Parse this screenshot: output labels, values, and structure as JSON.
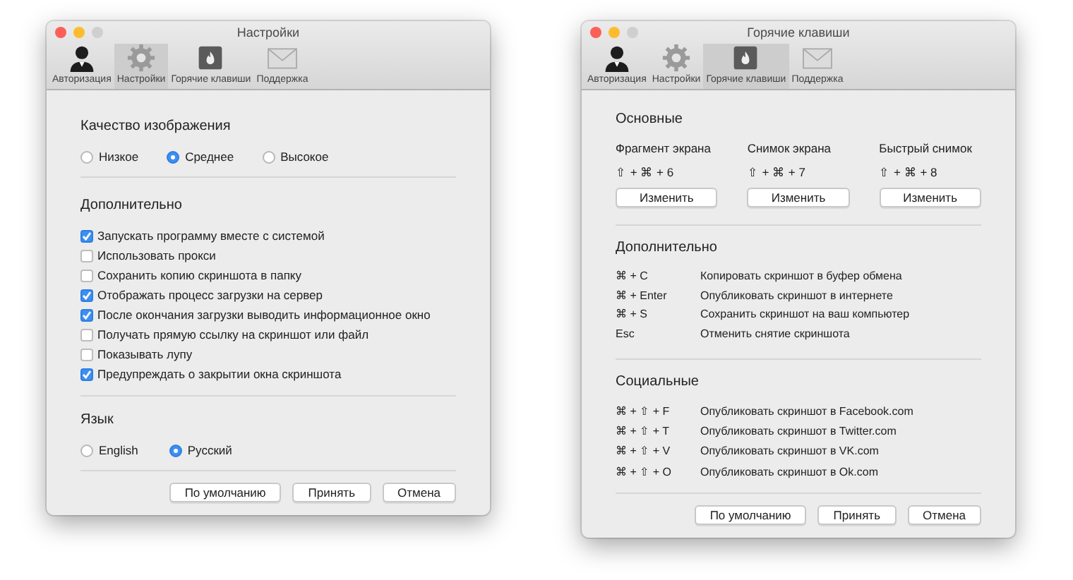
{
  "settings_window": {
    "title": "Настройки",
    "toolbar": [
      {
        "kind": "person",
        "label": "Авторизация",
        "selected": false
      },
      {
        "kind": "gear",
        "label": "Настройки",
        "selected": true
      },
      {
        "kind": "flame",
        "label": "Горячие клавиши",
        "selected": false
      },
      {
        "kind": "envelope",
        "label": "Поддержка",
        "selected": false
      }
    ],
    "quality": {
      "heading": "Качество изображения",
      "options": [
        {
          "label": "Низкое",
          "selected": false
        },
        {
          "label": "Среднее",
          "selected": true
        },
        {
          "label": "Высокое",
          "selected": false
        }
      ]
    },
    "additional": {
      "heading": "Дополнительно",
      "options": [
        {
          "label": "Запускать программу вместе с системой",
          "checked": true
        },
        {
          "label": "Использовать прокси",
          "checked": false
        },
        {
          "label": "Сохранить копию скриншота в папку",
          "checked": false
        },
        {
          "label": "Отображать процесс загрузки на сервер",
          "checked": true
        },
        {
          "label": "После окончания загрузки выводить информационное окно",
          "checked": true
        },
        {
          "label": "Получать прямую ссылку на скриншот или файл",
          "checked": false
        },
        {
          "label": "Показывать лупу",
          "checked": false
        },
        {
          "label": "Предупреждать о закрытии окна скриншота",
          "checked": true
        }
      ]
    },
    "language": {
      "heading": "Язык",
      "options": [
        {
          "label": "English",
          "selected": false
        },
        {
          "label": "Русский",
          "selected": true
        }
      ]
    },
    "buttons": [
      "По умолчанию",
      "Принять",
      "Отмена"
    ]
  },
  "hotkeys_window": {
    "title": "Горячие клавиши",
    "toolbar": [
      {
        "kind": "person",
        "label": "Авторизация",
        "selected": false
      },
      {
        "kind": "gear",
        "label": "Настройки",
        "selected": false
      },
      {
        "kind": "flame",
        "label": "Горячие клавиши",
        "selected": true
      },
      {
        "kind": "envelope",
        "label": "Поддержка",
        "selected": false
      }
    ],
    "main": {
      "heading": "Основные",
      "shortcuts": [
        {
          "name": "Фрагмент экрана",
          "keys": "⇧ + ⌘ + 6",
          "button": "Изменить"
        },
        {
          "name": "Снимок экрана",
          "keys": "⇧ + ⌘ + 7",
          "button": "Изменить"
        },
        {
          "name": "Быстрый снимок",
          "keys": "⇧ + ⌘ + 8",
          "button": "Изменить"
        }
      ]
    },
    "additional": {
      "heading": "Дополнительно",
      "rows": [
        {
          "keys": "⌘ + C",
          "action": "Копировать скриншот в буфер обмена"
        },
        {
          "keys": "⌘ + Enter",
          "action": "Опубликовать скриншот в интернете"
        },
        {
          "keys": "⌘ + S",
          "action": "Сохранить скриншот на ваш компьютер"
        },
        {
          "keys": "Esc",
          "action": "Отменить снятие скриншота"
        }
      ]
    },
    "social": {
      "heading": "Социальные",
      "rows": [
        {
          "keys": "⌘ + ⇧ + F",
          "action": "Опубликовать скриншот в Facebook.com"
        },
        {
          "keys": "⌘ + ⇧ + T",
          "action": "Опубликовать скриншот в Twitter.com"
        },
        {
          "keys": "⌘ + ⇧ + V",
          "action": "Опубликовать скриншот в VK.com"
        },
        {
          "keys": "⌘ + ⇧ + O",
          "action": "Опубликовать скриншот в Ok.com"
        }
      ]
    },
    "buttons": [
      "По умолчанию",
      "Принять",
      "Отмена"
    ]
  }
}
